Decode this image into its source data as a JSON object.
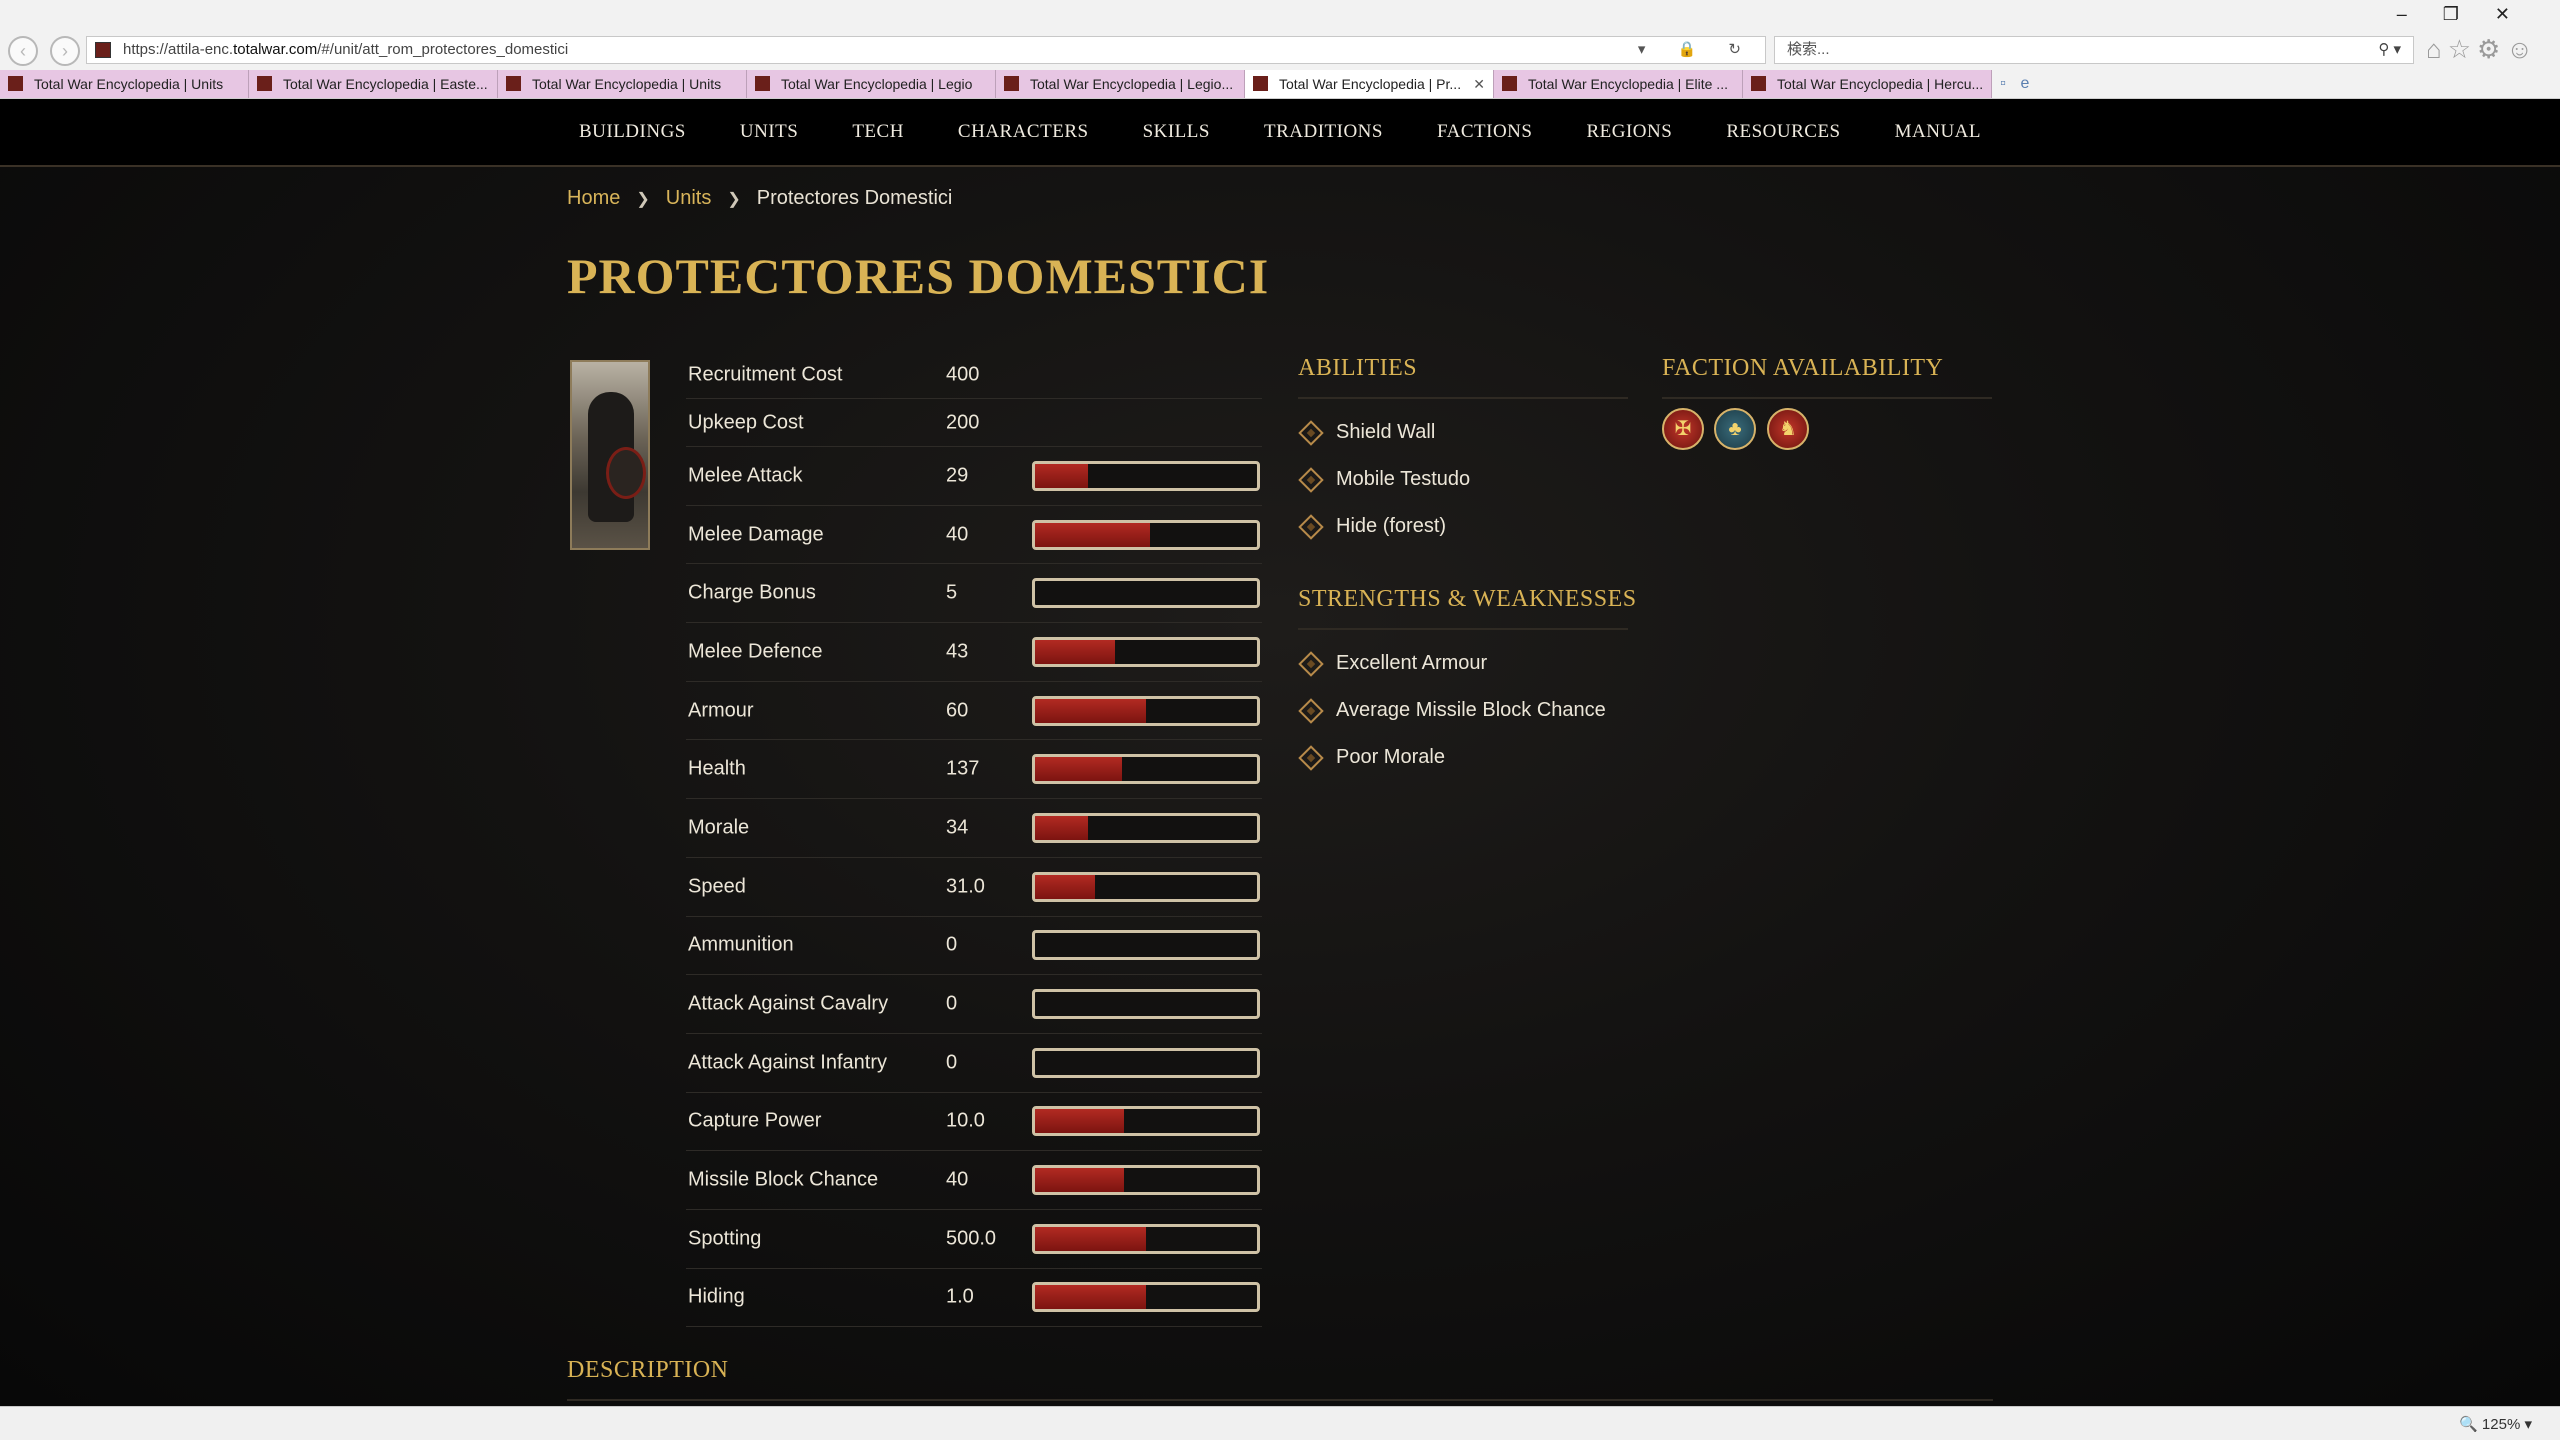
{
  "browser": {
    "url_prefix": "https://attila-enc.",
    "url_domain": "totalwar.com",
    "url_rest": "/#/unit/att_rom_protectores_domestici",
    "search_placeholder": "検索...",
    "tabs": [
      {
        "label": "Total War Encyclopedia | Units"
      },
      {
        "label": "Total War Encyclopedia | Easte..."
      },
      {
        "label": "Total War Encyclopedia | Units"
      },
      {
        "label": "Total War Encyclopedia | Legio"
      },
      {
        "label": "Total War Encyclopedia | Legio..."
      },
      {
        "label": "Total War Encyclopedia | Pr..."
      },
      {
        "label": "Total War Encyclopedia | Elite ..."
      },
      {
        "label": "Total War Encyclopedia | Hercu..."
      }
    ],
    "active_tab_index": 5,
    "zoom": "125%"
  },
  "nav": [
    "BUILDINGS",
    "UNITS",
    "TECH",
    "CHARACTERS",
    "SKILLS",
    "TRADITIONS",
    "FACTIONS",
    "REGIONS",
    "RESOURCES",
    "MANUAL"
  ],
  "breadcrumb": {
    "home": "Home",
    "units": "Units",
    "current": "Protectores Domestici"
  },
  "title": "PROTECTORES DOMESTICI",
  "stats": [
    {
      "label": "Recruitment Cost",
      "value": "400"
    },
    {
      "label": "Upkeep Cost",
      "value": "200"
    },
    {
      "label": "Melee Attack",
      "value": "29",
      "bar": 0.24
    },
    {
      "label": "Melee Damage",
      "value": "40",
      "bar": 0.52
    },
    {
      "label": "Charge Bonus",
      "value": "5",
      "bar": 0.0
    },
    {
      "label": "Melee Defence",
      "value": "43",
      "bar": 0.36
    },
    {
      "label": "Armour",
      "value": "60",
      "bar": 0.5
    },
    {
      "label": "Health",
      "value": "137",
      "bar": 0.39
    },
    {
      "label": "Morale",
      "value": "34",
      "bar": 0.24
    },
    {
      "label": "Speed",
      "value": "31.0",
      "bar": 0.27
    },
    {
      "label": "Ammunition",
      "value": "0",
      "bar": 0.0
    },
    {
      "label": "Attack Against Cavalry",
      "value": "0",
      "bar": 0.0
    },
    {
      "label": "Attack Against Infantry",
      "value": "0",
      "bar": 0.0
    },
    {
      "label": "Capture Power",
      "value": "10.0",
      "bar": 0.4
    },
    {
      "label": "Missile Block Chance",
      "value": "40",
      "bar": 0.4
    },
    {
      "label": "Spotting",
      "value": "500.0",
      "bar": 0.5
    },
    {
      "label": "Hiding",
      "value": "1.0",
      "bar": 0.5
    }
  ],
  "abilities": {
    "heading": "ABILITIES",
    "items": [
      "Shield Wall",
      "Mobile Testudo",
      "Hide (forest)"
    ]
  },
  "strengths": {
    "heading": "STRENGTHS & WEAKNESSES",
    "items": [
      "Excellent Armour",
      "Average Missile Block Chance",
      "Poor Morale"
    ]
  },
  "factions": {
    "heading": "FACTION AVAILABILITY",
    "icons": [
      "eagle-emblem-icon",
      "tree-emblem-icon",
      "beast-emblem-icon"
    ]
  },
  "description_heading": "DESCRIPTION",
  "colors": {
    "gold": "#d9b355",
    "bar_red": "#b22a22",
    "link": "#d8b45a"
  }
}
